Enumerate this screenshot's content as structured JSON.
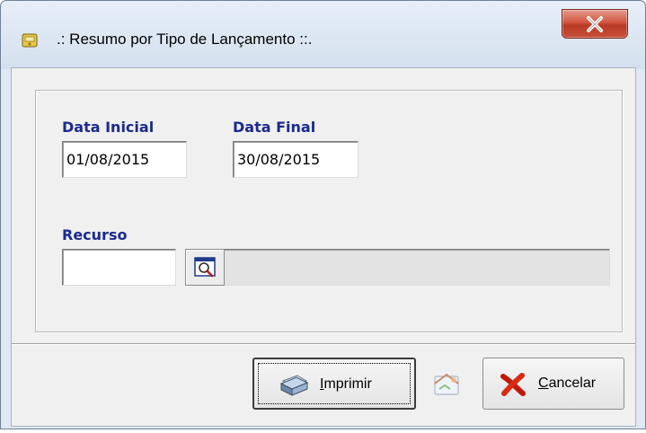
{
  "window": {
    "title": ".: Resumo por Tipo de Lançamento ::.",
    "close_icon": "close-icon"
  },
  "form": {
    "data_inicial": {
      "label": "Data Inicial",
      "value": "01/08/2015"
    },
    "data_final": {
      "label": "Data Final",
      "value": "30/08/2015"
    },
    "recurso": {
      "label": "Recurso",
      "code_value": "",
      "description_value": ""
    }
  },
  "buttons": {
    "imprimir": {
      "accel": "I",
      "rest": "mprimir",
      "icon": "printer-icon"
    },
    "export": {
      "icon": "export-icon"
    },
    "cancelar": {
      "accel": "C",
      "rest": "ancelar",
      "icon": "red-x-icon"
    }
  },
  "colors": {
    "label_blue": "#1b2a8f",
    "close_red": "#c9503a",
    "titlebar": "#dfe8f3"
  }
}
